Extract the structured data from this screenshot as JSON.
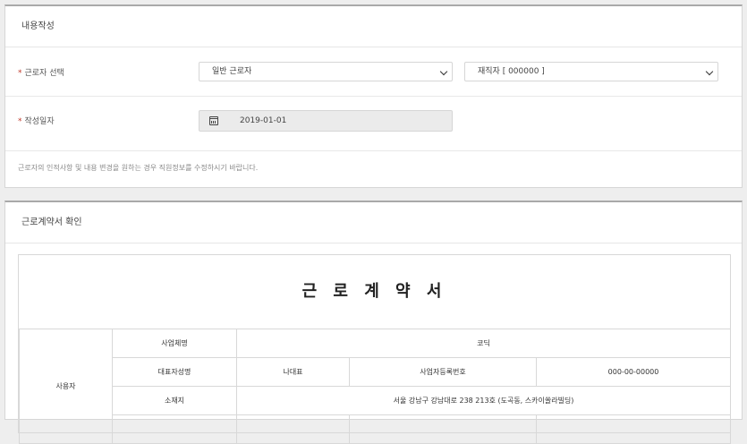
{
  "section1": {
    "title": "내용작성",
    "worker_select": {
      "required_mark": "*",
      "label": "근로자 선택",
      "type_value": "일반 근로자",
      "status_value": "재직자 [ 000000 ]"
    },
    "date": {
      "required_mark": "*",
      "label": "작성일자",
      "value": "2019-01-01"
    },
    "notice": "근로자의 인적사항 및 내용 변경을 원하는 경우 직원정보를 수정하시기 바랍니다."
  },
  "section2": {
    "title": "근로계약서 확인",
    "contract": {
      "title": "근 로 계 약 서",
      "employer_label": "사용자",
      "business_name_label": "사업체명",
      "business_name_value": "코딕",
      "ceo_label": "대표자성명",
      "ceo_value": "나대표",
      "reg_no_label": "사업자등록번호",
      "reg_no_value": "000-00-00000",
      "address_label": "소재지",
      "address_value": "서울 강남구 강남대로 238 213호 (도곡동, 스카이쏠라빌딩)"
    }
  }
}
